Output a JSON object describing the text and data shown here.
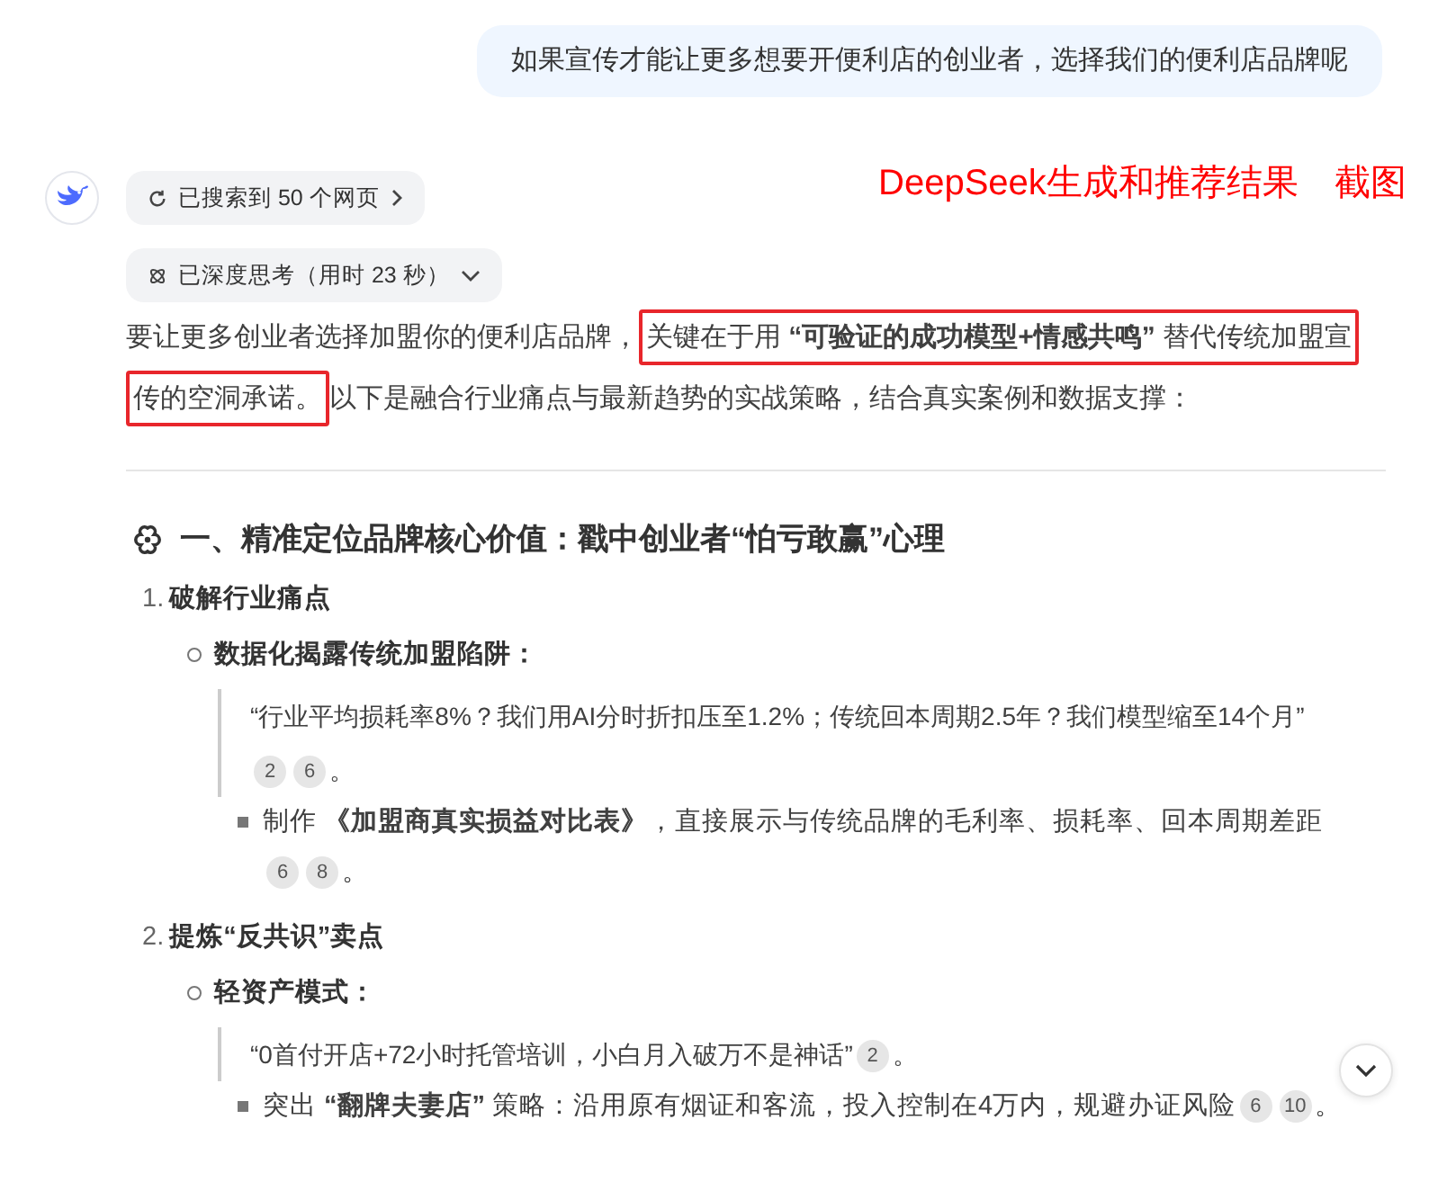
{
  "user_message": "如果宣传才能让更多想要开便利店的创业者，选择我们的便利店品牌呢",
  "annotation": [
    "DeepSeek生成和推荐结果",
    "截图"
  ],
  "search_chip": {
    "label": "已搜索到 50 个网页"
  },
  "thinking_chip": {
    "label": "已深度思考（用时 23 秒）",
    "expanded": false
  },
  "intro": [
    {
      "text": "要让更多创业者选择加盟你的便利店品牌，",
      "highlighted": false
    },
    {
      "text": "关键在于用 **“可验证的成功模型+情感共鸣”** 替代传统加盟宣传的空洞承诺。",
      "highlighted": true
    },
    {
      "text": "以下是融合行业痛点与最新趋势的实战策略，结合真实案例和数据支撑：",
      "highlighted": false
    }
  ],
  "section": {
    "title": "一、精准定位品牌核心价值：戳中创业者“怕亏敢赢”心理",
    "items": [
      {
        "number": "1.",
        "title": "破解行业痛点",
        "children": [
          {
            "title": "数据化揭露传统加盟陷阱：",
            "quote": {
              "text": "“行业平均损耗率8%？我们用AI分时折扣压至1.2%；传统回本周期2.5年？我们模型缩至14个月”",
              "citations": [
                "2",
                "6"
              ],
              "end": "。"
            },
            "bullets": [
              {
                "text": "制作 **《加盟商真实损益对比表》**，直接展示与传统品牌的毛利率、损耗率、回本周期差距",
                "citations": [
                  "6",
                  "8"
                ],
                "end": "。"
              }
            ]
          }
        ]
      },
      {
        "number": "2.",
        "title": "提炼“反共识”卖点",
        "children": [
          {
            "title": "轻资产模式：",
            "quote": {
              "text": "“0首付开店+72小时托管培训，小白月入破万不是神话”",
              "citations": [
                "2"
              ],
              "end": "。"
            },
            "bullets": [
              {
                "text": "突出 **“翻牌夫妻店”** 策略：沿用原有烟证和客流，投入控制在4万内，规避办证风险",
                "citations": [
                  "6",
                  "10"
                ],
                "end": "。"
              }
            ]
          }
        ]
      }
    ]
  }
}
